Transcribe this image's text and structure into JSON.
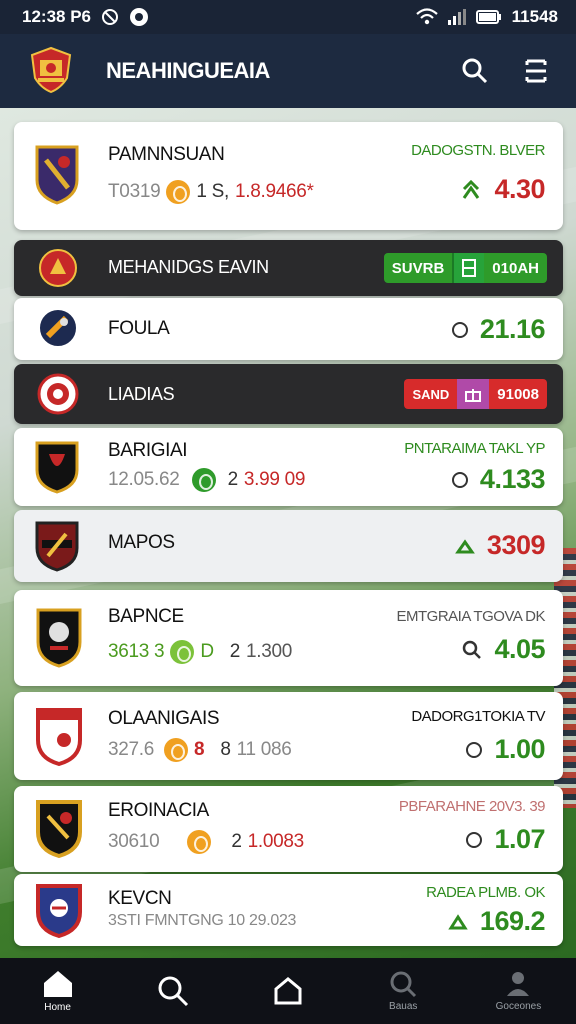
{
  "status_bar": {
    "time": "12:38 P6",
    "battery": "11548"
  },
  "app": {
    "title": "NEAHINGUEAIA"
  },
  "matches": [
    {
      "name": "PAMNNSUAN",
      "sub1": "T0319",
      "sub2": "1 S,",
      "sub3": "1.8.9466*",
      "market": "DADOGSTN. BLVER",
      "odds": "4.30"
    },
    {
      "name": "MEHANIDGS EAVIN",
      "pill_a": "SUVRB",
      "pill_b": "010AH"
    },
    {
      "name": "FOULA",
      "odds": "21.16"
    },
    {
      "name": "LIADIAS",
      "pill_a": "SAND",
      "pill_b": "91008"
    },
    {
      "name": "BARIGIAI",
      "sub1": "12.05.62",
      "sub2": "2",
      "sub3": "3.99 09",
      "market": "PNTARAIMA TAKL YP",
      "odds": "4.133"
    },
    {
      "name": "MAPOS",
      "odds": "3309"
    },
    {
      "name": "BAPNCE",
      "sub1": "3613 3",
      "sub_mid": "D",
      "sub2": "2",
      "sub3": "1.300",
      "market": "EMTGRAIA TGOVA DK",
      "odds": "4.05"
    },
    {
      "name": "OLAANIGAIS",
      "sub1": "327.6",
      "sub_mid": "8",
      "sub2": "8",
      "sub3": "11 086",
      "market": "DADORG1TOKIA TV",
      "odds": "1.00"
    },
    {
      "name": "EROINACIA",
      "sub1": "30610",
      "sub2": "2",
      "sub3": "1.0083",
      "market": "PBFARAHNE 20V3. 39",
      "odds": "1.07"
    },
    {
      "name": "KEVCN",
      "sub1": "3STI FMNTGNG 10 29.023",
      "market": "RADEA PLMB. OK",
      "odds": "169.2"
    }
  ],
  "nav": [
    {
      "label": "Home",
      "icon": "home-icon"
    },
    {
      "label": "",
      "icon": "search-icon"
    },
    {
      "label": "",
      "icon": "house-outline-icon"
    },
    {
      "label": "Bauas",
      "icon": "search-icon"
    },
    {
      "label": "Goceones",
      "icon": "profile-icon"
    }
  ],
  "colors": {
    "accent_green": "#2e8b1f",
    "accent_red": "#c62828",
    "appbar": "#1d2a40",
    "statusbar": "#1a2436"
  }
}
